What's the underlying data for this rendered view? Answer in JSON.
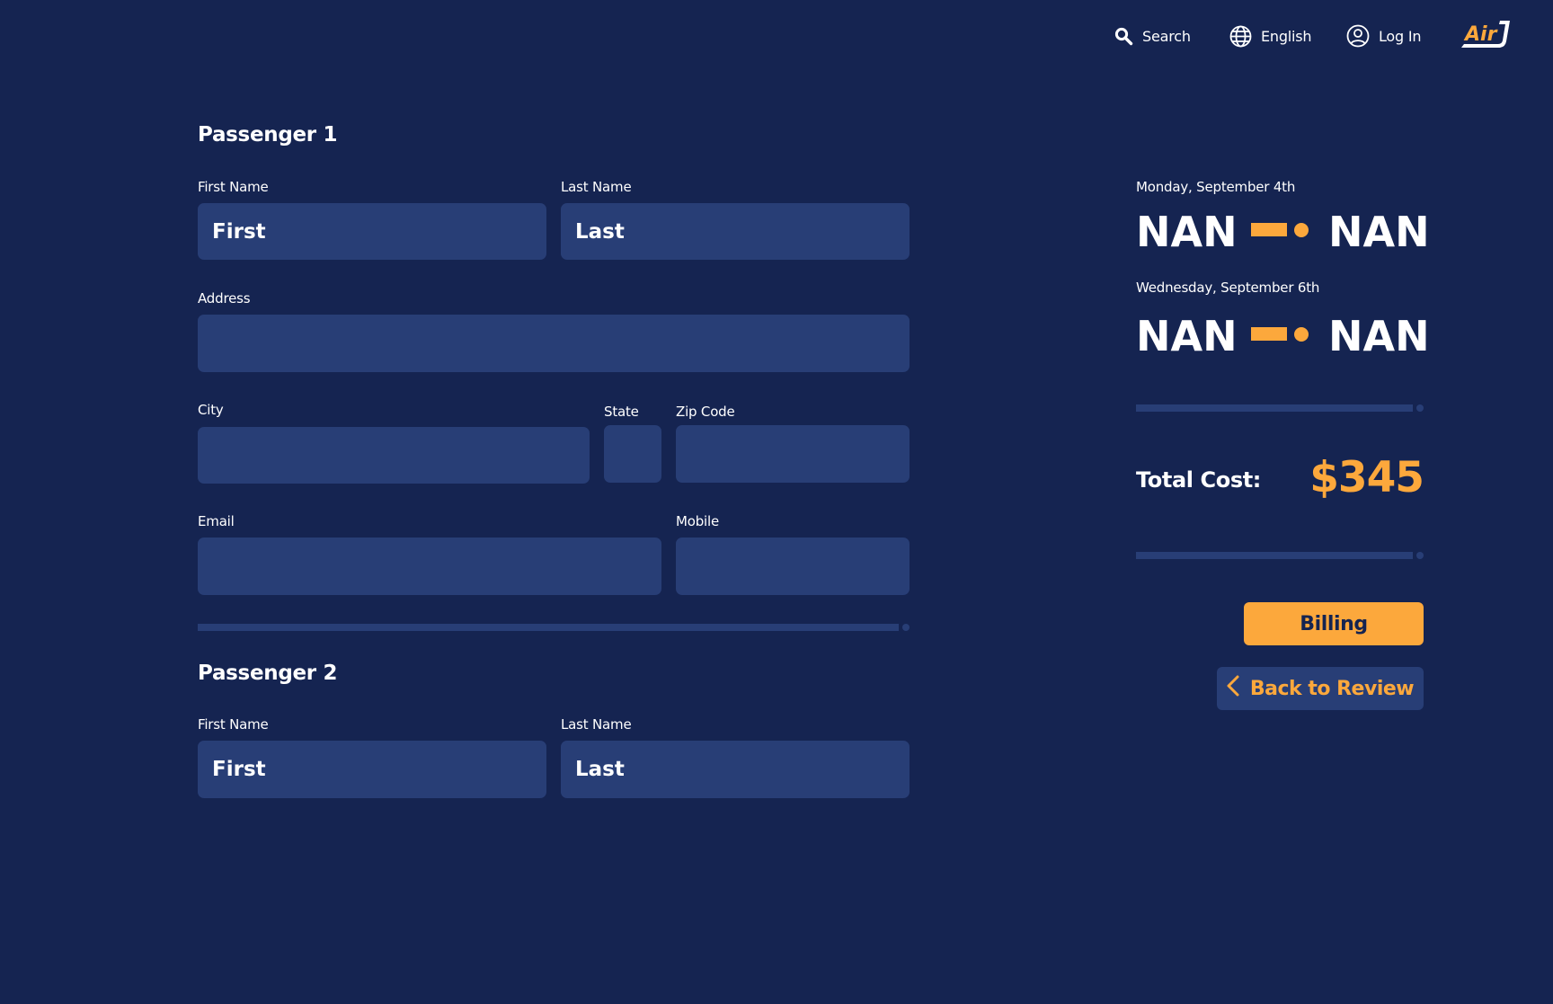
{
  "header": {
    "search_label": "Search",
    "language_label": "English",
    "login_label": "Log In",
    "logo_text": "Air",
    "icons": [
      "search-icon",
      "globe-icon",
      "user-circle-icon"
    ]
  },
  "colors": {
    "background": "#152451",
    "input_fill": "#283e76",
    "accent": "#fca83c",
    "text": "#ffffff"
  },
  "passengers": [
    {
      "title": "Passenger 1",
      "fields": {
        "first_name": {
          "label": "First Name",
          "placeholder": "First",
          "value": ""
        },
        "last_name": {
          "label": "Last Name",
          "placeholder": "Last",
          "value": ""
        },
        "address": {
          "label": "Address",
          "placeholder": "",
          "value": ""
        },
        "city": {
          "label": "City",
          "placeholder": "",
          "value": ""
        },
        "state": {
          "label": "State",
          "placeholder": "",
          "value": ""
        },
        "zip": {
          "label": "Zip Code",
          "placeholder": "",
          "value": ""
        },
        "email": {
          "label": "Email",
          "placeholder": "",
          "value": ""
        },
        "mobile": {
          "label": "Mobile",
          "placeholder": "",
          "value": ""
        }
      }
    },
    {
      "title": "Passenger 2",
      "fields": {
        "first_name": {
          "label": "First Name",
          "placeholder": "First",
          "value": ""
        },
        "last_name": {
          "label": "Last Name",
          "placeholder": "Last",
          "value": ""
        }
      }
    }
  ],
  "summary": {
    "flights": [
      {
        "date": "Monday, September 4th",
        "origin": "NAN",
        "destination": "NAN"
      },
      {
        "date": "Wednesday, September 6th",
        "origin": "NAN",
        "destination": "NAN"
      }
    ],
    "total_label": "Total Cost:",
    "total_value": "$345",
    "billing_button": "Billing",
    "back_button": "Back to Review"
  }
}
